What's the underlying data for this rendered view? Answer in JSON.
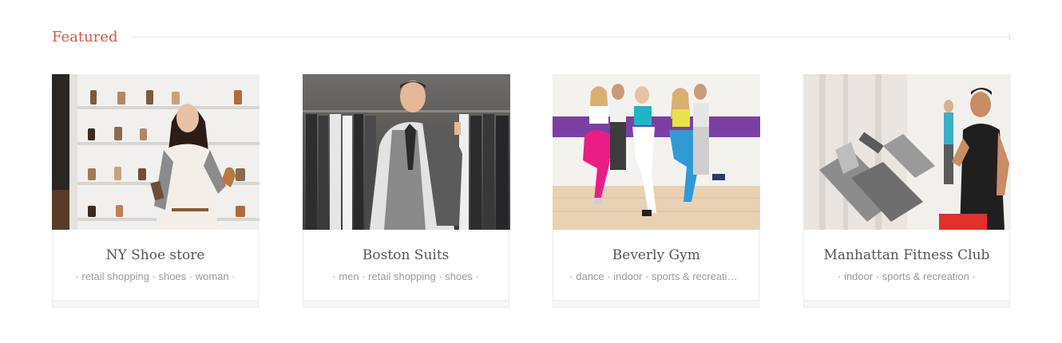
{
  "section": {
    "title": "Featured",
    "accent_color": "#d0574d"
  },
  "cards": [
    {
      "title": "NY Shoe store",
      "tags": "· retail shopping · shoes · woman ·",
      "image": "woman-in-shoe-store-photo"
    },
    {
      "title": "Boston Suits",
      "tags": "· men · retail shopping · shoes ·",
      "image": "man-in-suit-photo"
    },
    {
      "title": "Beverly Gym",
      "tags": "· dance · indoor · sports & recreation ·",
      "image": "dance-class-photo"
    },
    {
      "title": "Manhattan Fitness Club",
      "tags": "· indoor · sports & recreation ·",
      "image": "man-on-treadmill-photo"
    }
  ]
}
